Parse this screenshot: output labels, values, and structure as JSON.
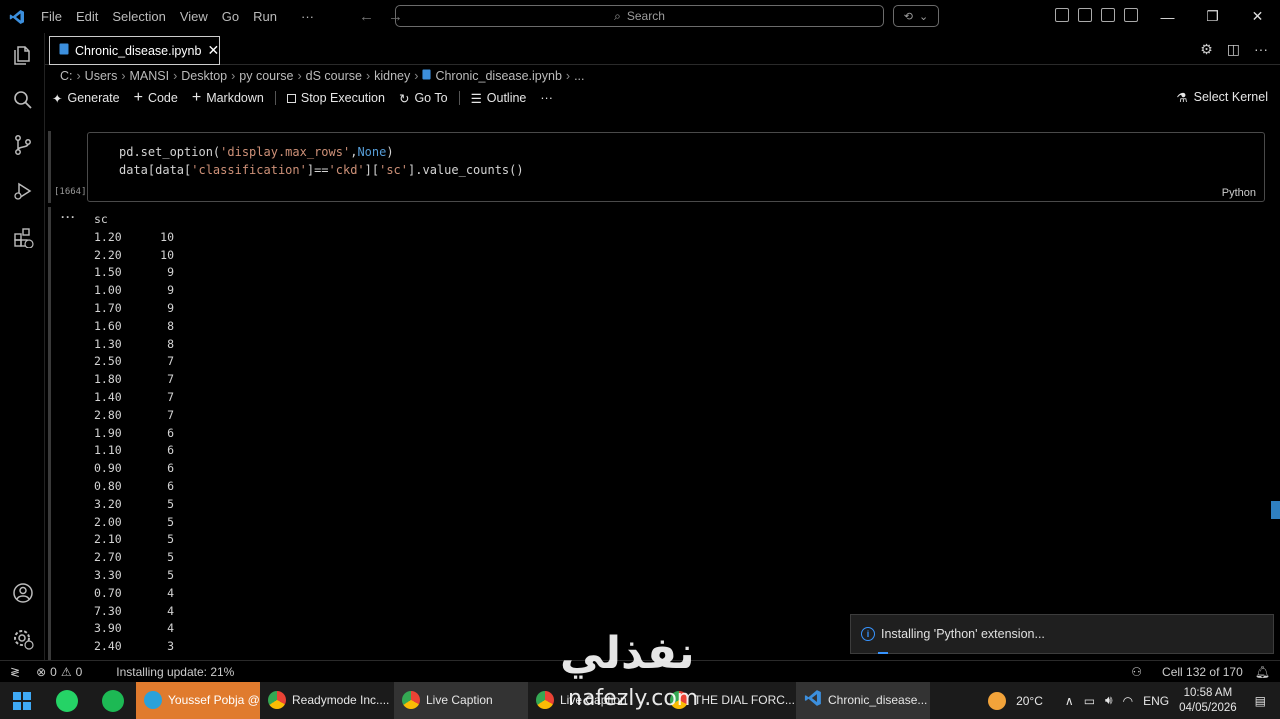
{
  "titlebar": {
    "menu": [
      "File",
      "Edit",
      "Selection",
      "View",
      "Go",
      "Run",
      "···"
    ],
    "search_placeholder": "Search"
  },
  "tab": {
    "label": "Chronic_disease.ipynb"
  },
  "breadcrumb": [
    "C:",
    "Users",
    "MANSI",
    "Desktop",
    "py course",
    "dS course",
    "kidney",
    "Chronic_disease.ipynb",
    "..."
  ],
  "toolbar": {
    "generate": "Generate",
    "code": "Code",
    "markdown": "Markdown",
    "stop": "Stop Execution",
    "goto": "Go To",
    "outline": "Outline",
    "more": "···",
    "kernel": "Select Kernel"
  },
  "cell": {
    "exec_count": "[1664]",
    "language": "Python",
    "line1_a": "pd.set_option(",
    "line1_str": "'display.max_rows'",
    "line1_b": ",",
    "line1_kw": "None",
    "line1_c": ")",
    "line2_a": "data[data[",
    "line2_str1": "'classification'",
    "line2_b": "]==",
    "line2_str2": "'ckd'",
    "line2_c": "][",
    "line2_str3": "'sc'",
    "line2_d": "].value_counts()"
  },
  "output": {
    "dots": "···",
    "header": "sc",
    "rows": [
      [
        "1.20",
        "10"
      ],
      [
        "2.20",
        "10"
      ],
      [
        "1.50",
        "9"
      ],
      [
        "1.00",
        "9"
      ],
      [
        "1.70",
        "9"
      ],
      [
        "1.60",
        "8"
      ],
      [
        "1.30",
        "8"
      ],
      [
        "2.50",
        "7"
      ],
      [
        "1.80",
        "7"
      ],
      [
        "1.40",
        "7"
      ],
      [
        "2.80",
        "7"
      ],
      [
        "1.90",
        "6"
      ],
      [
        "1.10",
        "6"
      ],
      [
        "0.90",
        "6"
      ],
      [
        "0.80",
        "6"
      ],
      [
        "3.20",
        "5"
      ],
      [
        "2.00",
        "5"
      ],
      [
        "2.10",
        "5"
      ],
      [
        "2.70",
        "5"
      ],
      [
        "3.30",
        "5"
      ],
      [
        "0.70",
        "4"
      ],
      [
        "7.30",
        "4"
      ],
      [
        "3.90",
        "4"
      ],
      [
        "2.40",
        "3"
      ]
    ]
  },
  "notification": {
    "text": "Installing 'Python' extension..."
  },
  "statusbar": {
    "errors": "0",
    "warnings": "0",
    "update": "Installing update: 21%",
    "cell_pos": "Cell 132 of 170"
  },
  "watermark": {
    "arabic": "نفذلي",
    "latin": "nafezly.com"
  },
  "taskbar": {
    "apps": [
      {
        "label": "Youssef Pobja @...",
        "style": "orange"
      },
      {
        "label": "Readymode Inc....",
        "style": ""
      },
      {
        "label": "Live Caption",
        "style": "active"
      },
      {
        "label": "Live Caption",
        "style": ""
      },
      {
        "label": "THE DIAL FORC...",
        "style": ""
      },
      {
        "label": "Chronic_disease...",
        "style": "active"
      }
    ],
    "temperature": "20°C",
    "language": "ENG",
    "time": "10:58 AM",
    "date": "04/05/2026"
  },
  "colors": {
    "accent": "#3794ff",
    "string": "#ce9178",
    "keyword": "#569cd6"
  }
}
